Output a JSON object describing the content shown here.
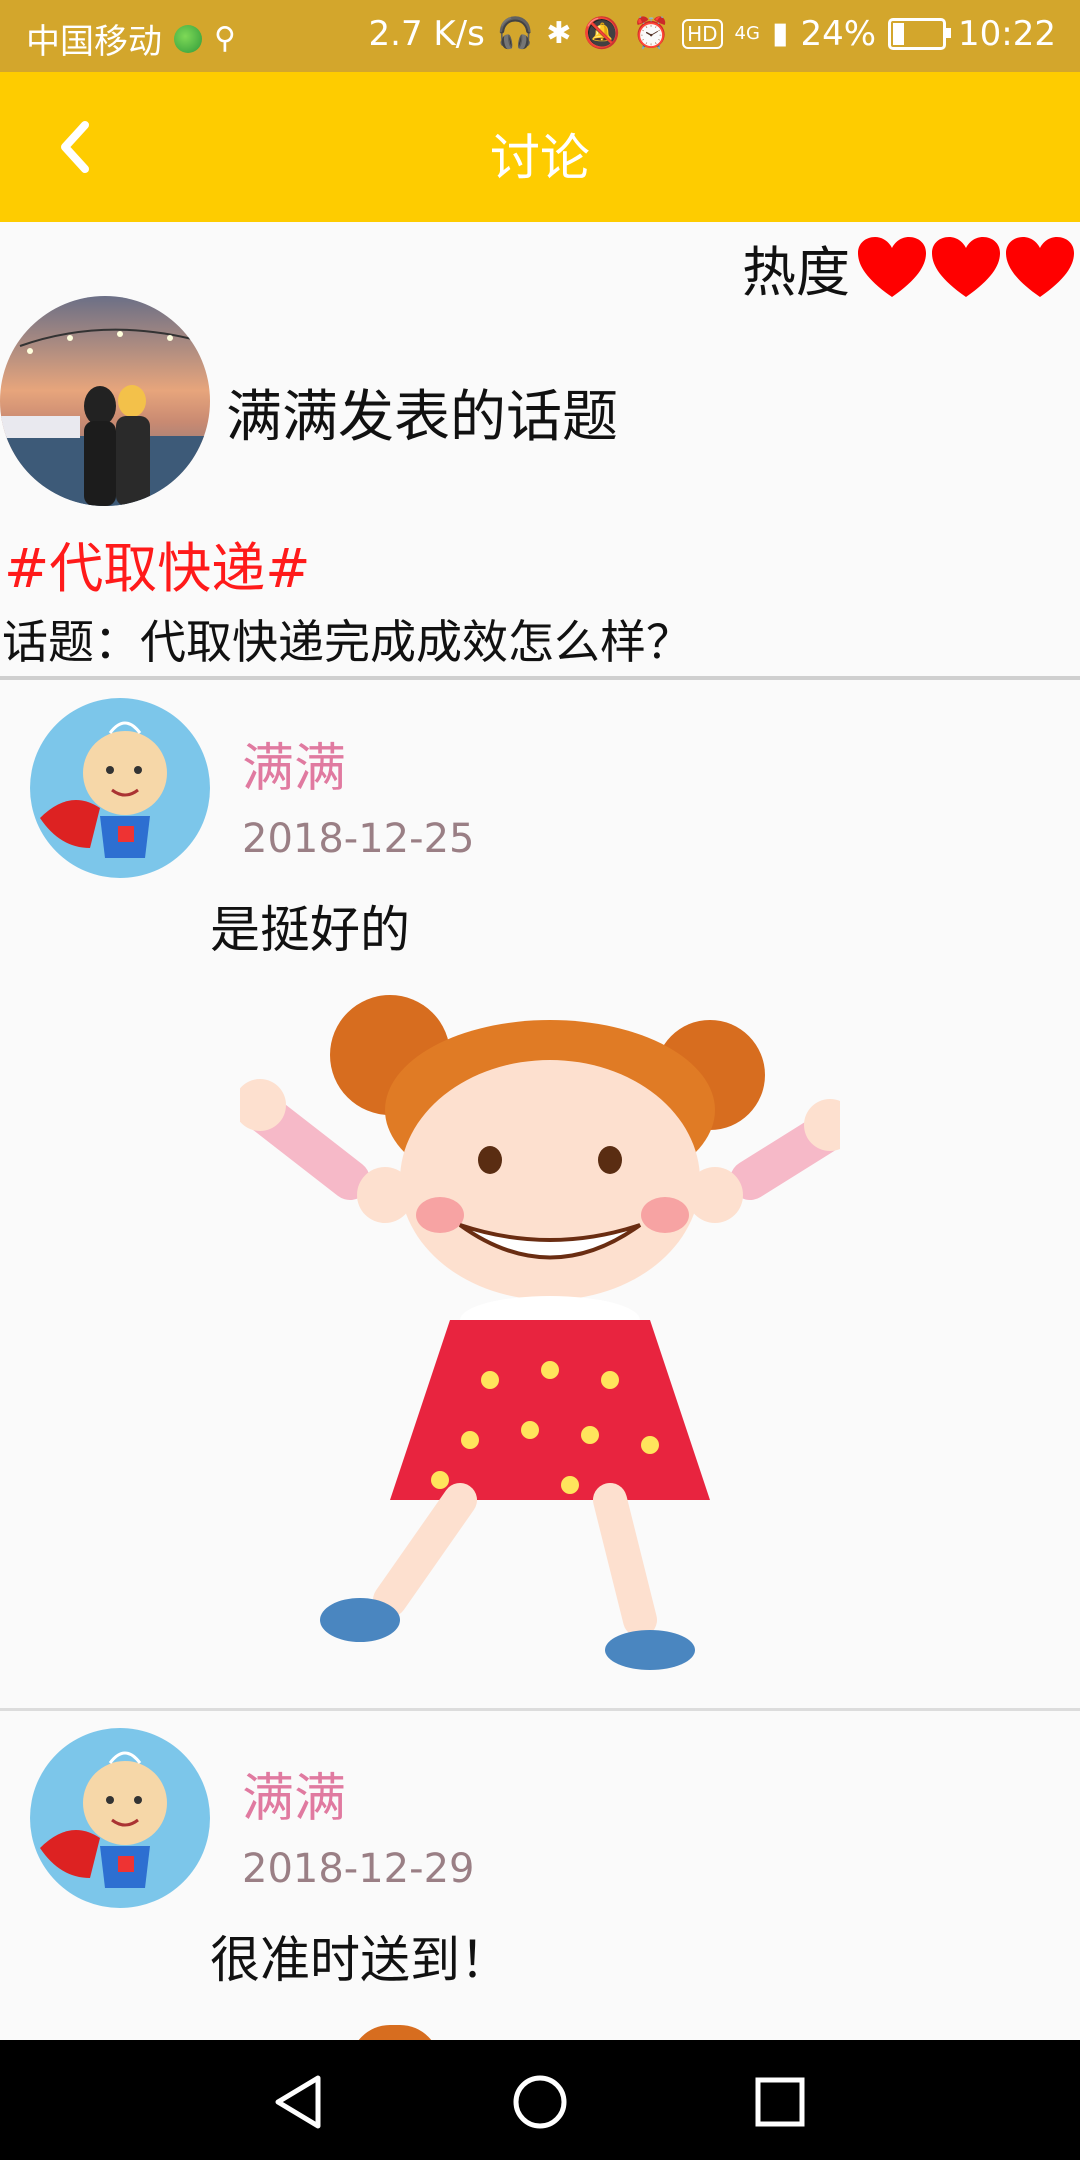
{
  "status_bar": {
    "carrier": "中国移动",
    "net_speed": "2.7 K/s",
    "hd": "HD",
    "signal_type": "4G",
    "battery": "24%",
    "battery_level": 0.24,
    "time": "10:22"
  },
  "appbar": {
    "title": "讨论",
    "back_icon": "chevron-left-icon"
  },
  "header": {
    "heat_label": "热度",
    "heat_count": 3,
    "heart_color": "#ff0000",
    "poster_title": "满满发表的话题",
    "topic_tag": "#代取快递#",
    "topic_line": "话题：代取快递完成成效怎么样？"
  },
  "comments": [
    {
      "name": "满满",
      "date": "2018-12-25",
      "text": "是挺好的"
    },
    {
      "name": "满满",
      "date": "2018-12-29",
      "text": "很准时送到！"
    }
  ],
  "colors": {
    "status_bar": "#d3a62c",
    "appbar": "#fecc00",
    "topic_red": "#ff1a1a",
    "name_pink": "#e07aa0",
    "date_gray": "#9a7f85"
  }
}
